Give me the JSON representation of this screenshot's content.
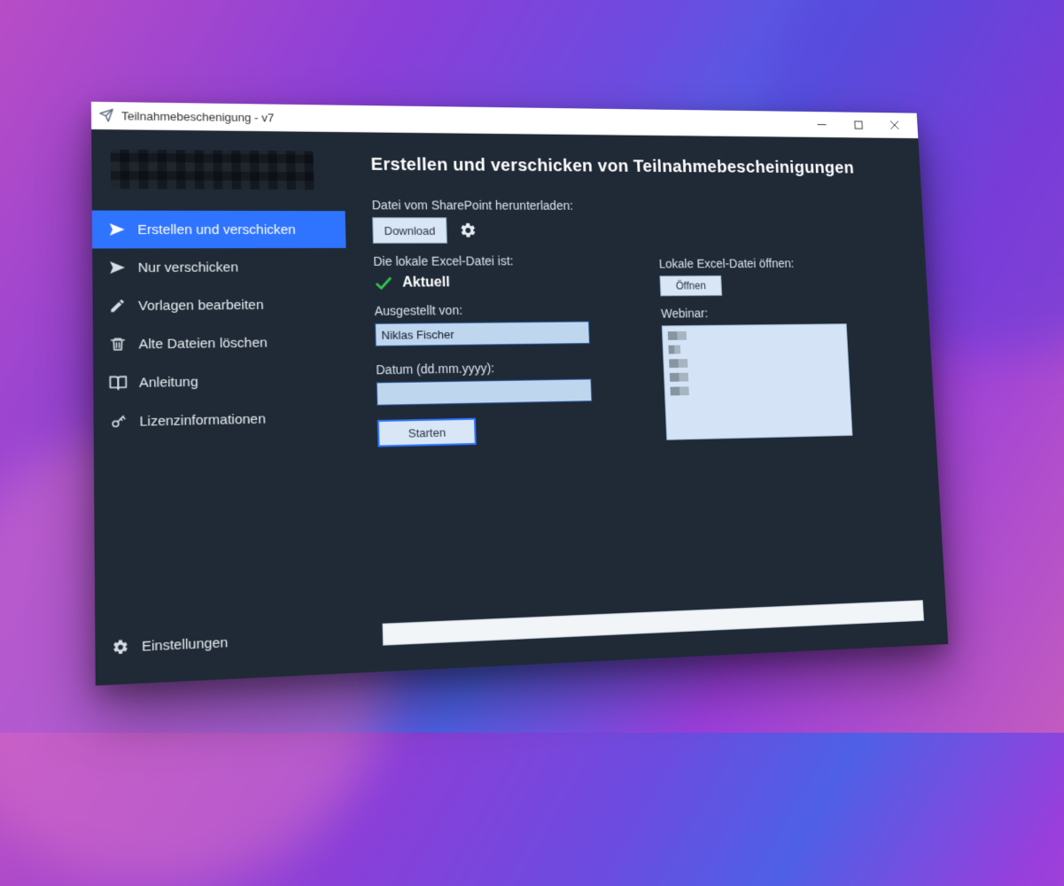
{
  "titlebar": {
    "title": "Teilnahmebeschenigung - v7"
  },
  "sidebar": {
    "items": [
      {
        "label": "Erstellen und verschicken",
        "icon": "paper-plane"
      },
      {
        "label": "Nur verschicken",
        "icon": "paper-plane"
      },
      {
        "label": "Vorlagen bearbeiten",
        "icon": "pencil"
      },
      {
        "label": "Alte Dateien löschen",
        "icon": "trash"
      },
      {
        "label": "Anleitung",
        "icon": "book"
      },
      {
        "label": "Lizenzinformationen",
        "icon": "key"
      }
    ],
    "settings_label": "Einstellungen"
  },
  "main": {
    "heading": "Erstellen und verschicken von Teilnahmebescheinigungen",
    "download_label": "Datei vom SharePoint herunterladen:",
    "download_button": "Download",
    "local_file_label": "Die lokale Excel-Datei ist:",
    "local_file_status": "Aktuell",
    "issued_by_label": "Ausgestellt von:",
    "issued_by_value": "Niklas Fischer",
    "date_label": "Datum (dd.mm.yyyy):",
    "date_value": "",
    "start_button": "Starten",
    "open_label": "Lokale Excel-Datei öffnen:",
    "open_button": "Öffnen",
    "webinar_label": "Webinar:"
  }
}
